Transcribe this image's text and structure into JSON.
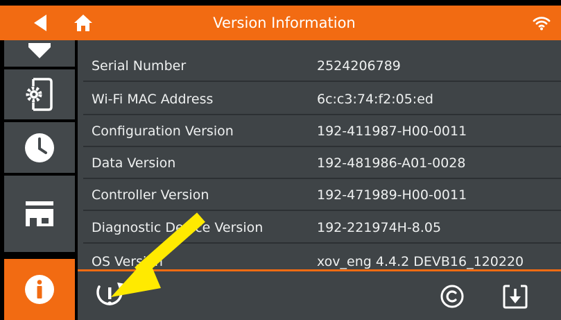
{
  "header": {
    "title": "Version Information",
    "accent_color": "#f26b12",
    "back_icon": "back-arrow-icon",
    "home_icon": "home-icon",
    "status_icon": "wifi-icon"
  },
  "sidebar": {
    "items": [
      {
        "icon": "download-box-icon",
        "active": false
      },
      {
        "icon": "phone-settings-icon",
        "active": false
      },
      {
        "icon": "clock-icon",
        "active": false
      },
      {
        "icon": "store-icon",
        "active": false
      },
      {
        "icon": "info-icon",
        "active": true
      }
    ]
  },
  "info_rows": [
    {
      "label": "Serial Number",
      "value": "2524206789"
    },
    {
      "label": "Wi-Fi MAC Address",
      "value": "6c:c3:74:f2:05:ed"
    },
    {
      "label": "Configuration Version",
      "value": "192-411987-H00-0011"
    },
    {
      "label": "Data Version",
      "value": "192-481986-A01-0028"
    },
    {
      "label": "Controller Version",
      "value": "192-471989-H00-0011"
    },
    {
      "label": "Diagnostic Device Version",
      "value": "192-221974H-8.05"
    },
    {
      "label": "OS Version",
      "value": "xov_eng 4.4.2 DEVB16_120220"
    }
  ],
  "footer": {
    "buttons": [
      {
        "name": "restart",
        "icon": "restart-warning-icon"
      },
      {
        "name": "copyright",
        "icon": "copyright-icon"
      },
      {
        "name": "download",
        "icon": "download-icon"
      }
    ]
  },
  "annotation": {
    "icon": "yellow-arrow-icon",
    "color": "#ffea00"
  }
}
